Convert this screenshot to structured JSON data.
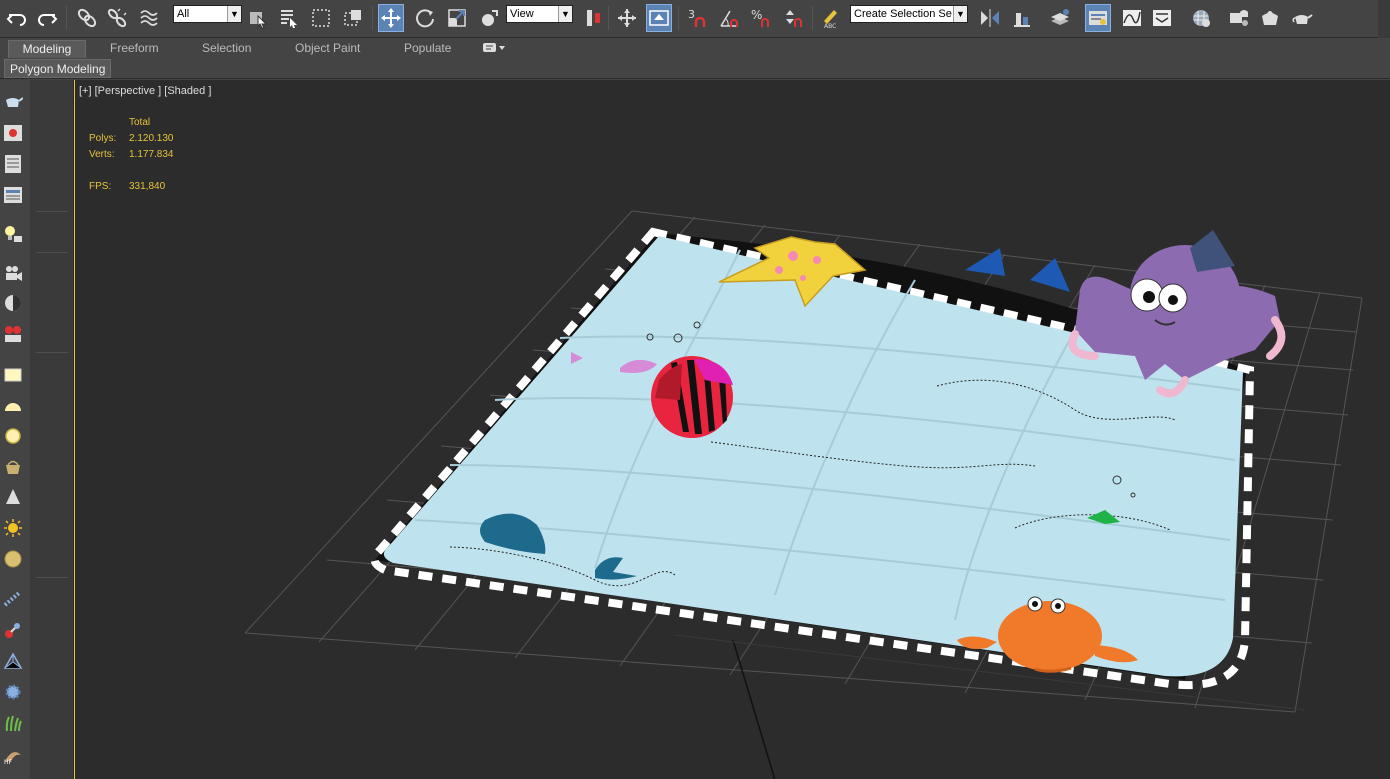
{
  "toolbar": {
    "selection_filter": "All",
    "reference_coord": "View",
    "named_selection": "Create Selection Se",
    "icons": [
      "undo-icon",
      "redo-icon",
      "link-icon",
      "unlink-icon",
      "bind-space-warp-icon",
      "select-object-icon",
      "select-by-name-icon",
      "rect-selection-region-icon",
      "window-crossing-icon",
      "move-icon",
      "rotate-icon",
      "scale-icon",
      "placement-icon",
      "use-pivot-icon",
      "snap-3d-icon",
      "angle-snap-icon",
      "percent-snap-icon",
      "spinner-snap-icon",
      "edit-named-selection-icon",
      "mirror-icon",
      "align-icon",
      "layer-explorer-icon",
      "scene-explorer-icon",
      "curve-editor-icon",
      "schematic-view-icon",
      "material-editor-icon",
      "render-setup-icon",
      "render-frame-icon",
      "render-icon",
      "render-teapot-icon"
    ],
    "snap_value": "3"
  },
  "ribbon": {
    "tabs": [
      "Modeling",
      "Freeform",
      "Selection",
      "Object Paint",
      "Populate"
    ],
    "active_tab": "Modeling",
    "sub_tab": "Polygon Modeling"
  },
  "viewport": {
    "label": "[+] [Perspective ] [Shaded ]",
    "stats_header": "Total",
    "polys_label": "Polys:",
    "polys_value": "2.120.130",
    "verts_label": "Verts:",
    "verts_value": "1.177.834",
    "fps_label": "FPS:",
    "fps_value": "331,840"
  },
  "colors": {
    "accent_blue": "#5b84b5",
    "viewport_border": "#e6c33a",
    "stats_text": "#e6c33a",
    "mat_blue": "#bfe3ee",
    "octopus_purple": "#8d6bb0",
    "crab_orange": "#f07a2a",
    "starfish_yellow": "#f2d23c"
  },
  "left_strip_icons": [
    "teapot-icon",
    "scene-icon",
    "list-icon",
    "panel-icon",
    "light-bulb-icon",
    "camera-icon",
    "helper-icon",
    "render-settings-icon",
    "box-icon",
    "hemisphere-icon",
    "sphere-icon",
    "basket-icon",
    "cone-icon",
    "sun-icon",
    "disc-icon",
    "particles-icon",
    "dynamics-icon",
    "geometry-icon",
    "gear-icon",
    "grass-icon",
    "hair-fur-icon"
  ]
}
